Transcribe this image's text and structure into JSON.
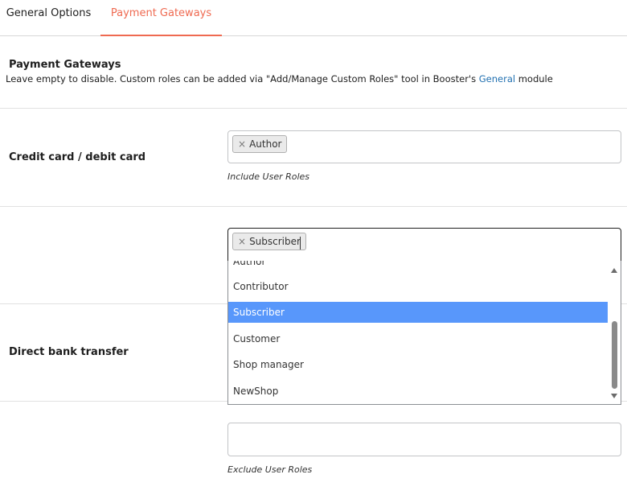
{
  "tabs": [
    {
      "label": "General Options",
      "active": false
    },
    {
      "label": "Payment Gateways",
      "active": true
    }
  ],
  "section": {
    "title": "Payment Gateways",
    "description_before": "Leave empty to disable. Custom roles can be added via \"Add/Manage Custom Roles\" tool in Booster's ",
    "description_link": "General",
    "description_after": " module"
  },
  "rows": [
    {
      "label": "Credit card / debit card",
      "include_chip": "Author",
      "include_help": "Include User Roles"
    },
    {
      "label": "Direct bank transfer",
      "include_chip": "Subscriber",
      "exclude_value": "",
      "exclude_help": "Exclude User Roles"
    }
  ],
  "chip_remove_glyph": "×",
  "dropdown": {
    "options": [
      "Author",
      "Contributor",
      "Subscriber",
      "Customer",
      "Shop manager",
      "NewShop"
    ],
    "highlighted": "Subscriber"
  },
  "colors": {
    "accent": "#ef6a51",
    "link": "#2271b1",
    "highlight": "#5897fb"
  }
}
